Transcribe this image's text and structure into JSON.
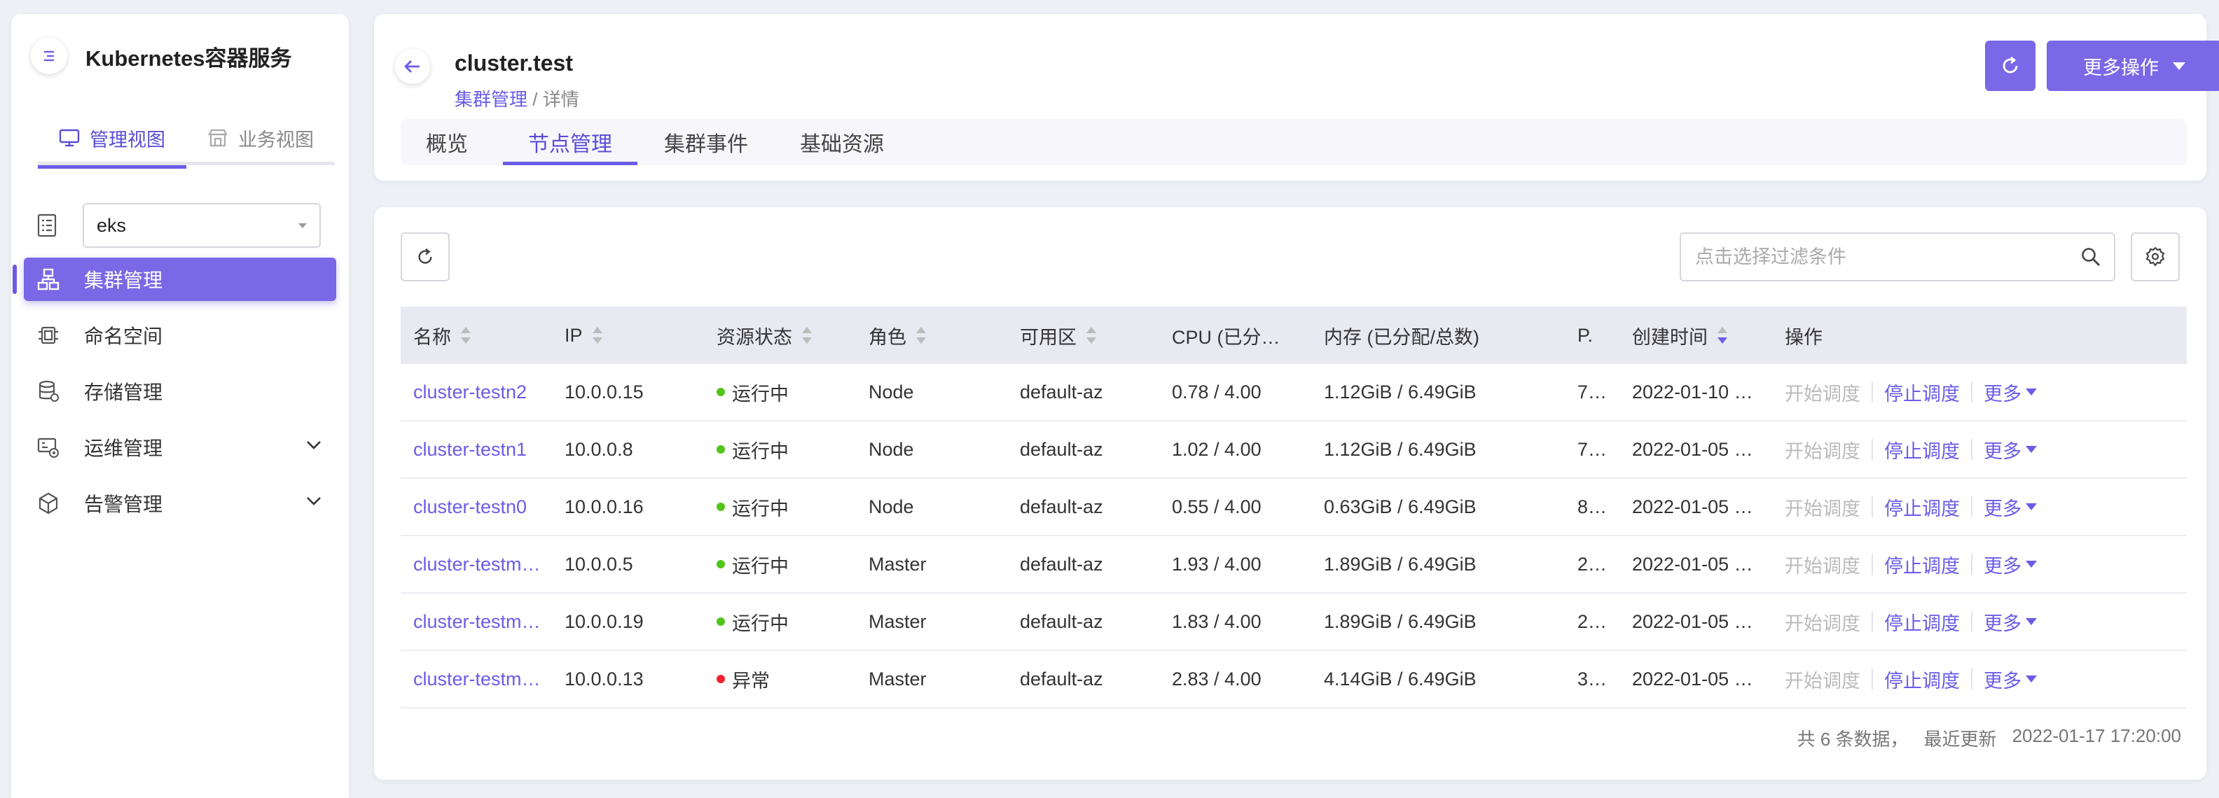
{
  "app": {
    "title": "Kubernetes容器服务"
  },
  "view_tabs": [
    {
      "label": "管理视图",
      "active": true
    },
    {
      "label": "业务视图",
      "active": false
    }
  ],
  "namespace_select": {
    "value": "eks"
  },
  "nav": [
    {
      "label": "集群管理",
      "icon": "cluster-icon",
      "active": true,
      "has_children": false
    },
    {
      "label": "命名空间",
      "icon": "namespace-icon",
      "active": false,
      "has_children": false
    },
    {
      "label": "存储管理",
      "icon": "storage-icon",
      "active": false,
      "has_children": false
    },
    {
      "label": "运维管理",
      "icon": "ops-icon",
      "active": false,
      "has_children": true
    },
    {
      "label": "告警管理",
      "icon": "alert-icon",
      "active": false,
      "has_children": true
    }
  ],
  "header": {
    "cluster_name": "cluster.test",
    "breadcrumb": {
      "parent": "集群管理",
      "separator": " / ",
      "current": "详情"
    },
    "more_ops_label": "更多操作"
  },
  "page_tabs": [
    {
      "label": "概览",
      "active": false
    },
    {
      "label": "节点管理",
      "active": true
    },
    {
      "label": "集群事件",
      "active": false
    },
    {
      "label": "基础资源",
      "active": false
    }
  ],
  "toolbar": {
    "filter_placeholder": "点击选择过滤条件"
  },
  "table": {
    "columns": [
      {
        "key": "name",
        "label": "名称",
        "sortable": true
      },
      {
        "key": "ip",
        "label": "IP",
        "sortable": true
      },
      {
        "key": "status",
        "label": "资源状态",
        "sortable": true
      },
      {
        "key": "role",
        "label": "角色",
        "sortable": true
      },
      {
        "key": "zone",
        "label": "可用区",
        "sortable": true
      },
      {
        "key": "cpu",
        "label": "CPU (已分…",
        "sortable": false
      },
      {
        "key": "memory",
        "label": "内存 (已分配/总数)",
        "sortable": false
      },
      {
        "key": "pods",
        "label": "P.",
        "sortable": false
      },
      {
        "key": "created",
        "label": "创建时间",
        "sortable": true,
        "sort_dir": "desc"
      },
      {
        "key": "actions",
        "label": "操作",
        "sortable": false
      }
    ],
    "rows": [
      {
        "name": "cluster-testn2",
        "ip": "10.0.0.15",
        "status": "运行中",
        "status_color": "#52c41a",
        "role": "Node",
        "zone": "default-az",
        "cpu": "0.78 / 4.00",
        "memory": "1.12GiB / 6.49GiB",
        "pods": "7…",
        "created": "2022-01-10 …"
      },
      {
        "name": "cluster-testn1",
        "ip": "10.0.0.8",
        "status": "运行中",
        "status_color": "#52c41a",
        "role": "Node",
        "zone": "default-az",
        "cpu": "1.02 / 4.00",
        "memory": "1.12GiB / 6.49GiB",
        "pods": "7…",
        "created": "2022-01-05 …"
      },
      {
        "name": "cluster-testn0",
        "ip": "10.0.0.16",
        "status": "运行中",
        "status_color": "#52c41a",
        "role": "Node",
        "zone": "default-az",
        "cpu": "0.55 / 4.00",
        "memory": "0.63GiB / 6.49GiB",
        "pods": "8…",
        "created": "2022-01-05 …"
      },
      {
        "name": "cluster-testm…",
        "ip": "10.0.0.5",
        "status": "运行中",
        "status_color": "#52c41a",
        "role": "Master",
        "zone": "default-az",
        "cpu": "1.93 / 4.00",
        "memory": "1.89GiB / 6.49GiB",
        "pods": "2…",
        "created": "2022-01-05 …"
      },
      {
        "name": "cluster-testm…",
        "ip": "10.0.0.19",
        "status": "运行中",
        "status_color": "#52c41a",
        "role": "Master",
        "zone": "default-az",
        "cpu": "1.83 / 4.00",
        "memory": "1.89GiB / 6.49GiB",
        "pods": "2…",
        "created": "2022-01-05 …"
      },
      {
        "name": "cluster-testm…",
        "ip": "10.0.0.13",
        "status": "异常",
        "status_color": "#f5222d",
        "role": "Master",
        "zone": "default-az",
        "cpu": "2.83 / 4.00",
        "memory": "4.14GiB / 6.49GiB",
        "pods": "3…",
        "created": "2022-01-05 …"
      }
    ],
    "row_actions": {
      "start": "开始调度",
      "stop": "停止调度",
      "more": "更多"
    }
  },
  "footer": {
    "count_text": "共 6 条数据，",
    "updated_label": "最近更新",
    "updated_time": "2022-01-17 17:20:00"
  },
  "colors": {
    "accent": "#6b5ce7",
    "accent_bg": "#7a68e6",
    "running": "#52c41a",
    "error": "#f5222d"
  }
}
